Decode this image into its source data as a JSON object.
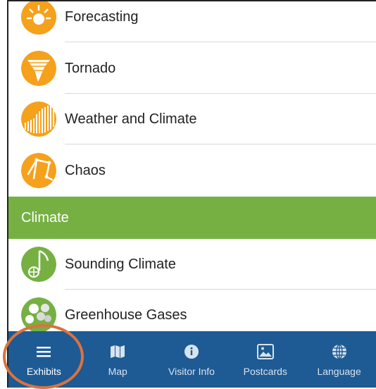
{
  "colors": {
    "accent_orange": "#f5a11c",
    "climate_green": "#76b043",
    "tabbar_blue": "#1e5a93",
    "highlight_ring": "#d9733f"
  },
  "list": {
    "items": [
      {
        "label": "Forecasting",
        "icon": "sun-gear-icon"
      },
      {
        "label": "Tornado",
        "icon": "tornado-icon"
      },
      {
        "label": "Weather and Climate",
        "icon": "bar-graph-icon"
      },
      {
        "label": "Chaos",
        "icon": "chaos-pendulum-icon"
      }
    ],
    "section": {
      "title": "Climate"
    },
    "climate_items": [
      {
        "label": "Sounding Climate",
        "icon": "music-note-globe-icon"
      },
      {
        "label": "Greenhouse Gases",
        "icon": "molecules-icon"
      }
    ]
  },
  "tabbar": {
    "tabs": [
      {
        "label": "Exhibits",
        "icon": "menu-icon"
      },
      {
        "label": "Map",
        "icon": "map-icon"
      },
      {
        "label": "Visitor Info",
        "icon": "info-icon"
      },
      {
        "label": "Postcards",
        "icon": "image-icon"
      },
      {
        "label": "Language",
        "icon": "globe-icon"
      }
    ]
  }
}
